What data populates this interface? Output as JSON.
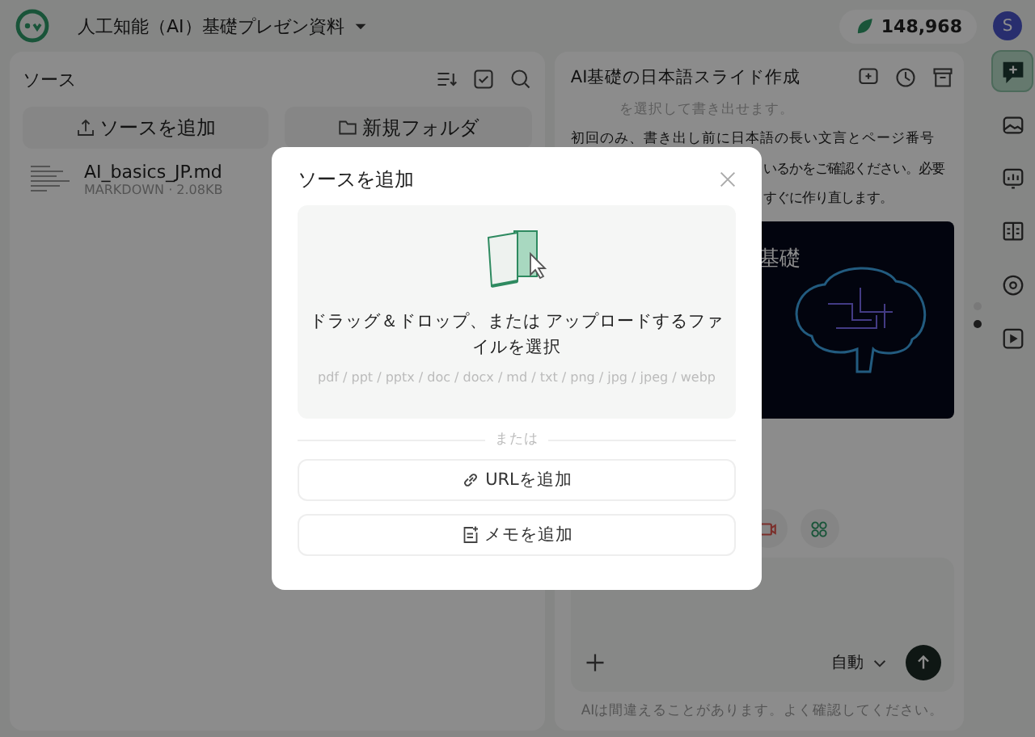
{
  "top_bar": {
    "title": "人工知能（AI）基礎プレゼン資料",
    "credits": "148,968",
    "avatar": "S"
  },
  "sources_panel": {
    "title": "ソース",
    "buttons": [
      "ソースを追加",
      "新規フォルダ"
    ],
    "files": [
      {
        "name": "AI_basics_JP.md",
        "meta": "MARKDOWN · 2.08KB"
      }
    ]
  },
  "chat_panel": {
    "title": "AI基礎の日本語スライド作成",
    "messages": [
      "を選択して書き出せます。",
      "初回のみ、書き出し前に日本語の長い文言とページ番号",
      "いるかをご確認ください。必要",
      "すぐに作り直します。"
    ],
    "slide_title": "基礎",
    "input_mode": "自動",
    "disclaimer": "AIは間違えることがあります。よく確認してください。"
  },
  "right_rail": {
    "items": [
      {
        "selected": true
      },
      {
        "selected": false
      },
      {
        "selected": false
      },
      {
        "selected": false
      },
      {
        "selected": false
      },
      {
        "selected": false
      }
    ]
  },
  "dialog": {
    "title": "ソースを追加",
    "drop_text": "ドラッグ＆ドロップ、または アップロードするファイルを選択",
    "formats": "pdf / ppt / pptx / doc / docx / md / txt / png / jpg / jpeg / webp",
    "separator": "または",
    "buttons": [
      "URLを追加",
      "メモを追加"
    ]
  }
}
